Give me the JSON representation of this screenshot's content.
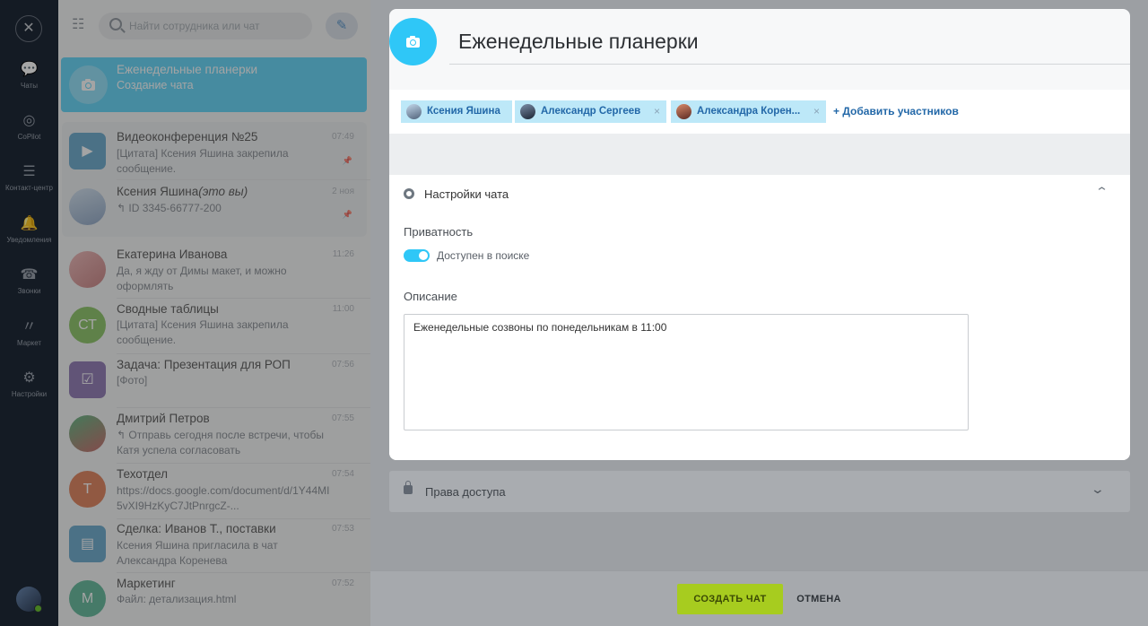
{
  "nav": {
    "close": "✕",
    "items": [
      {
        "icon": "chat-icon",
        "glyph": "💬",
        "label": "Чаты"
      },
      {
        "icon": "copilot-icon",
        "glyph": "◎",
        "label": "CoPilot"
      },
      {
        "icon": "contact-center-icon",
        "glyph": "☰",
        "label": "Контакт-центр"
      },
      {
        "icon": "bell-icon",
        "glyph": "🔔",
        "label": "Уведомления"
      },
      {
        "icon": "phone-icon",
        "glyph": "☎",
        "label": "Звонки"
      },
      {
        "icon": "market-icon",
        "glyph": "〃",
        "label": "Маркет"
      },
      {
        "icon": "gear-icon",
        "glyph": "⚙",
        "label": "Настройки"
      }
    ]
  },
  "search": {
    "placeholder": "Найти сотрудника или чат"
  },
  "active_chat": {
    "name": "Еженедельные планерки",
    "preview": "Создание чата"
  },
  "chats": [
    {
      "name": "Видеоконференция №25",
      "preview": "[Цитата] Ксения Яшина закрепила сообщение.",
      "time": "07:49",
      "color": "#3a8fbd"
    },
    {
      "name": "Ксения Яшина",
      "name_suffix": "(это вы)",
      "preview": "↰ ID 3345-66777-200",
      "time": "2 ноя",
      "color": "#8fa9c4"
    },
    {
      "name": "Екатерина Иванова",
      "preview": "Да, я жду от Димы макет, и можно оформлять",
      "time": "11:26",
      "color": "#b85b5b"
    },
    {
      "name": "Сводные таблицы",
      "preview": "[Цитата] Ксения Яшина закрепила сообщение.",
      "time": "11:00",
      "initials": "СТ",
      "color": "#67b236"
    },
    {
      "name": "Задача: Презентация для РОП",
      "preview": "[Фото]",
      "time": "07:56",
      "color": "#6a4f9b"
    },
    {
      "name": "Дмитрий Петров",
      "preview": "↰ Отправь сегодня после встречи, чтобы Катя успела согласовать",
      "time": "07:55",
      "color": "#b83a3a"
    },
    {
      "name": "Техотдел",
      "preview": "https://docs.google.com/document/d/1Y44MI5vXI9HzKyC7JtPnrgcZ-...",
      "time": "07:54",
      "initials": "Т",
      "color": "#d55a27"
    },
    {
      "name": "Сделка: Иванов Т., поставки",
      "preview": "Ксения Яшина пригласила в чат Александра Коренева",
      "time": "07:53",
      "color": "#3a8fbd"
    },
    {
      "name": "Маркетинг",
      "preview": "Файл: детализация.html",
      "time": "07:52",
      "initials": "М",
      "color": "#2fa37a"
    }
  ],
  "dialog": {
    "title": "Еженедельные планерки",
    "members": [
      {
        "name": "Ксения Яшина"
      },
      {
        "name": "Александр Сергеев",
        "remove": "×"
      },
      {
        "name": "Александра Корен...",
        "remove": "×"
      }
    ],
    "add_members": "+ Добавить участников",
    "settings_title": "Настройки чата",
    "privacy_label": "Приватность",
    "privacy_toggle_label": "Доступен в поиске",
    "privacy_enabled": true,
    "description_label": "Описание",
    "description_value": "Еженедельные созвоны по понедельникам в 11:00",
    "access_title": "Права доступа"
  },
  "footer": {
    "create": "СОЗДАТЬ ЧАТ",
    "cancel": "ОТМЕНА"
  },
  "colors": {
    "accent": "#2fc7f7",
    "create_button": "#a7cc1f",
    "link": "#2368a8"
  }
}
